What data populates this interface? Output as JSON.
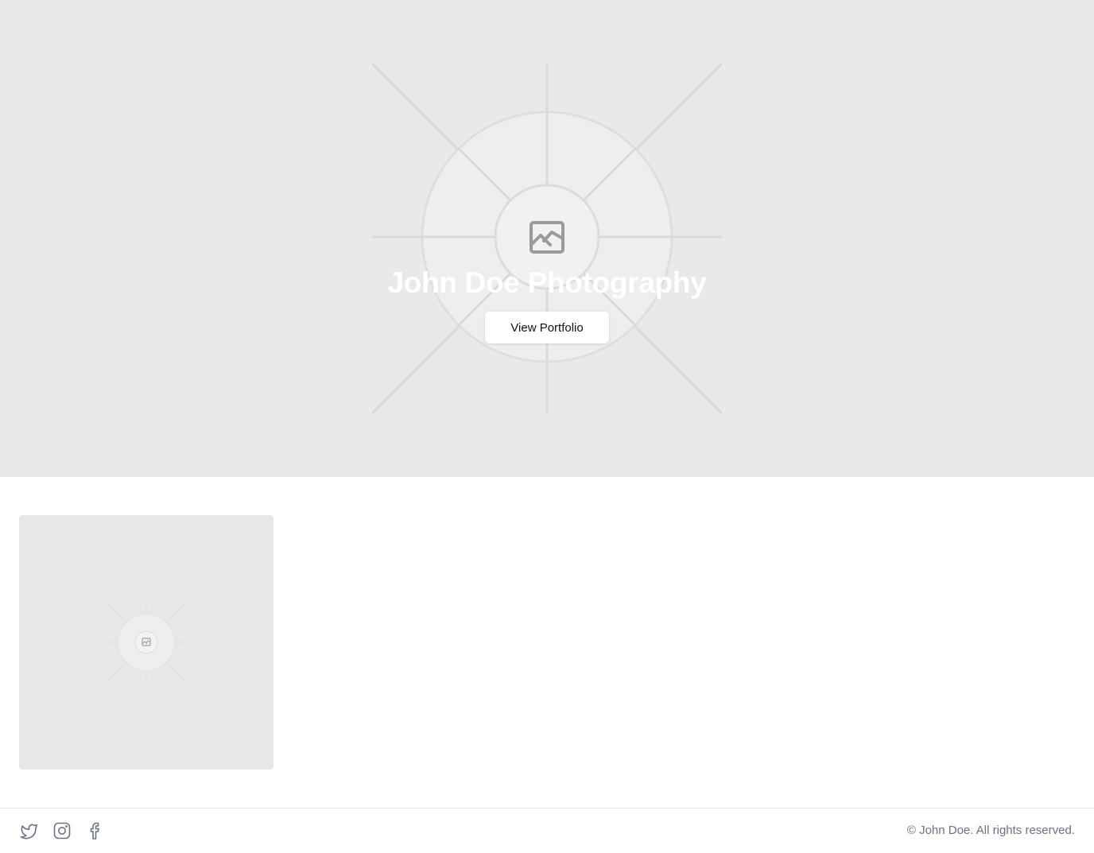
{
  "hero": {
    "title": "John Doe Photography",
    "cta_label": "View Portfolio",
    "image_icon": "image-placeholder-icon"
  },
  "gallery": {
    "items": [
      {
        "icon": "image-placeholder-icon"
      }
    ]
  },
  "footer": {
    "social": [
      {
        "name": "Twitter",
        "icon": "twitter-icon"
      },
      {
        "name": "Instagram",
        "icon": "instagram-icon"
      },
      {
        "name": "Facebook",
        "icon": "facebook-icon"
      }
    ],
    "copyright": "© John Doe. All rights reserved."
  },
  "colors": {
    "hero_background": "#e9e9e9",
    "card_background": "#e8e8e8",
    "footer_text": "#6b7280",
    "icon_stroke": "#6b7280"
  }
}
